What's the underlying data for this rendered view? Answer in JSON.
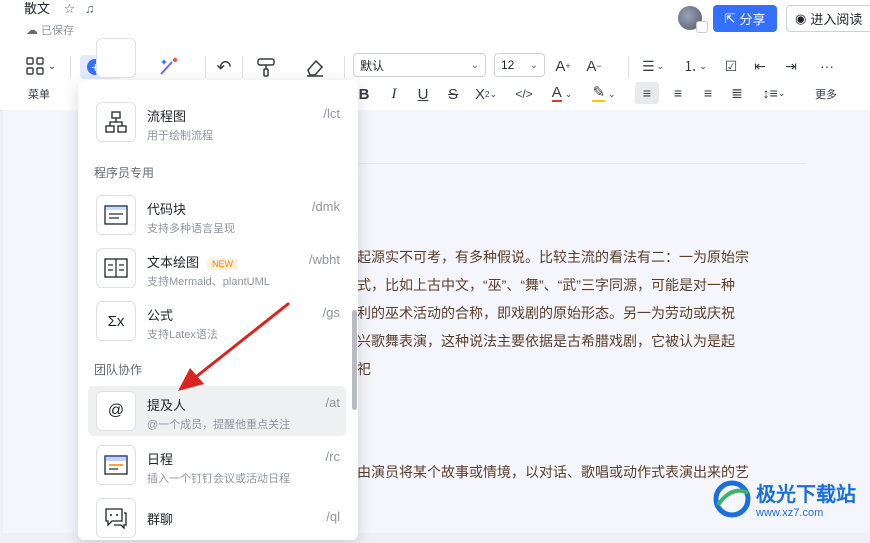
{
  "header": {
    "doc_title": "散文",
    "saved_status": "已保存",
    "share_label": "分享",
    "read_label": "进入阅读"
  },
  "toolbar": {
    "menu_label": "菜单",
    "more_label": "更多",
    "style_select": "默认",
    "size_select": "12"
  },
  "document": {
    "lines": [
      "起源实不可考，有多种假说。比较主流的看法有二：一为原始宗",
      "式，比如上古中文，“巫”、“舞”、“武”三字同源，可能是对一种",
      "利的巫术活动的合称，即戏剧的原始形态。另一为劳动或庆祝",
      "兴歌舞表演，这种说法主要依据是古希腊戏剧，它被认为是起",
      "祀",
      "由演员将某个故事或情境，以对话、歌唱或动作式表演出来的艺"
    ]
  },
  "insert_menu": {
    "items_top": [
      {
        "title": "流程图",
        "desc": "用于绘制流程",
        "shortcut": "/lct",
        "icon": "flowchart-icon"
      }
    ],
    "section_dev": "程序员专用",
    "items_dev": [
      {
        "title": "代码块",
        "desc": "支持多种语言呈现",
        "shortcut": "/dmk",
        "icon": "code-block-icon"
      },
      {
        "title": "文本绘图",
        "badge": "NEW",
        "desc": "支持Mermaid、plantUML",
        "shortcut": "/wbht",
        "icon": "text-diagram-icon"
      },
      {
        "title": "公式",
        "desc": "支持Latex语法",
        "shortcut": "/gs",
        "icon": "formula-icon"
      }
    ],
    "section_team": "团队协作",
    "items_team": [
      {
        "title": "提及人",
        "desc": "@一个成员，提醒他重点关注",
        "shortcut": "/at",
        "icon": "mention-icon"
      },
      {
        "title": "日程",
        "desc": "插入一个钉钉会议或活动日程",
        "shortcut": "/rc",
        "icon": "calendar-icon"
      },
      {
        "title": "群聊",
        "desc": "",
        "shortcut": "/ql",
        "icon": "group-chat-icon"
      }
    ]
  },
  "watermark": {
    "name": "极光下载站",
    "url": "www.xz7.com"
  },
  "colors": {
    "accent": "#3370ff",
    "annotation_arrow": "#d9241f",
    "doc_text": "#5a3e29"
  }
}
